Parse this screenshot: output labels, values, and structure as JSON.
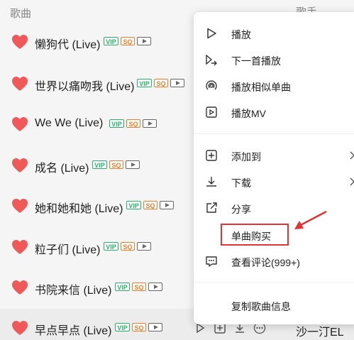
{
  "header": {
    "song_label": "歌曲",
    "artist_label": "歌手"
  },
  "colors": {
    "heart": "#f0595a",
    "vip": "#27b26a",
    "sq": "#f07c2a",
    "annotation": "#e53333"
  },
  "songs": [
    {
      "title": "懒狗代 (Live)",
      "badges": [
        "VIP",
        "SQ",
        "mv"
      ]
    },
    {
      "title": "世界以痛吻我 (Live)",
      "badges": [
        "VIP",
        "SQ",
        "mv"
      ]
    },
    {
      "title": "We We (Live)",
      "badges": [
        "VIP",
        "SQ",
        "mv"
      ]
    },
    {
      "title": "成名 (Live)",
      "badges": [
        "VIP",
        "SQ",
        "mv"
      ]
    },
    {
      "title": "她和她和她 (Live)",
      "badges": [
        "VIP",
        "SQ",
        "mv"
      ]
    },
    {
      "title": "粒子们 (Live)",
      "badges": [
        "VIP",
        "SQ",
        "mv"
      ]
    },
    {
      "title": "书院来信 (Live)",
      "badges": [
        "VIP",
        "SQ",
        "mv"
      ]
    },
    {
      "title": "早点早点 (Live)",
      "badges": [
        "VIP",
        "SQ",
        "mv"
      ],
      "artist": "沙一汀EL"
    }
  ],
  "badge_text": {
    "vip": "VIP",
    "sq": "SQ"
  },
  "context_menu": {
    "play": "播放",
    "play_next": "下一首播放",
    "play_similar": "播放相似单曲",
    "play_mv": "播放MV",
    "add_to": "添加到",
    "download": "下载",
    "share": "分享",
    "buy_single": "单曲购买",
    "view_comments": "查看评论(999+)",
    "copy_info": "复制歌曲信息"
  }
}
